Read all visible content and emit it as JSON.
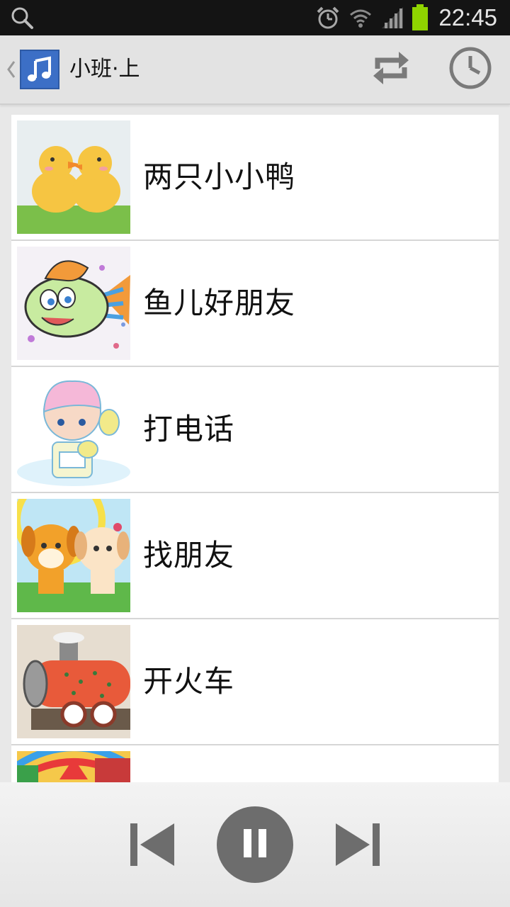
{
  "status_bar": {
    "time": "22:45",
    "icons": [
      "search-icon",
      "alarm-icon",
      "wifi-icon",
      "signal-icon",
      "battery-icon"
    ]
  },
  "action_bar": {
    "title": "小班·上",
    "icons": [
      "back-chevron-icon",
      "music-note-icon",
      "repeat-icon",
      "history-clock-icon"
    ]
  },
  "songs": [
    {
      "title": "两只小小鸭",
      "thumb": "ducklings-image"
    },
    {
      "title": "鱼儿好朋友",
      "thumb": "fish-image"
    },
    {
      "title": "打电话",
      "thumb": "baby-phone-image"
    },
    {
      "title": "找朋友",
      "thumb": "puppies-image"
    },
    {
      "title": "开火车",
      "thumb": "train-image"
    },
    {
      "title": "",
      "thumb": "partial-image"
    }
  ],
  "player": {
    "state": "playing",
    "icons": [
      "previous-track-icon",
      "pause-icon",
      "next-track-icon"
    ]
  },
  "colors": {
    "status_bar": "#141414",
    "action_bar": "#e3e3e3",
    "app_icon": "#3c6fc6",
    "battery": "#8fd400",
    "control_icon": "#6d6d6d"
  }
}
